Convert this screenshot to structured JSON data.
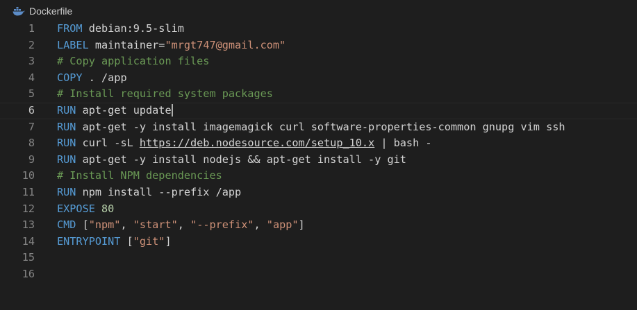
{
  "file": {
    "name": "Dockerfile",
    "icon": "docker-whale-icon"
  },
  "editor": {
    "current_line": 6,
    "lines": [
      {
        "number": "1",
        "tokens": [
          {
            "t": "FROM",
            "c": "kw"
          },
          {
            "t": " debian:9.5-slim",
            "c": ""
          }
        ]
      },
      {
        "number": "2",
        "tokens": [
          {
            "t": "LABEL",
            "c": "kw"
          },
          {
            "t": " maintainer=",
            "c": ""
          },
          {
            "t": "\"mrgt747@gmail.com\"",
            "c": "str"
          }
        ]
      },
      {
        "number": "3",
        "tokens": [
          {
            "t": "# Copy application files",
            "c": "cm"
          }
        ]
      },
      {
        "number": "4",
        "tokens": [
          {
            "t": "COPY",
            "c": "kw"
          },
          {
            "t": " . /app",
            "c": ""
          }
        ]
      },
      {
        "number": "5",
        "tokens": [
          {
            "t": "# Install required system packages",
            "c": "cm"
          }
        ]
      },
      {
        "number": "6",
        "tokens": [
          {
            "t": "RUN",
            "c": "kw"
          },
          {
            "t": " apt-get update",
            "c": ""
          }
        ]
      },
      {
        "number": "7",
        "tokens": [
          {
            "t": "RUN",
            "c": "kw"
          },
          {
            "t": " apt-get -y install imagemagick curl software-properties-common gnupg vim ssh",
            "c": ""
          }
        ]
      },
      {
        "number": "8",
        "tokens": [
          {
            "t": "RUN",
            "c": "kw"
          },
          {
            "t": " curl -sL ",
            "c": ""
          },
          {
            "t": "https://deb.nodesource.com/setup_10.x",
            "c": "url"
          },
          {
            "t": " | bash -",
            "c": ""
          }
        ]
      },
      {
        "number": "9",
        "tokens": [
          {
            "t": "RUN",
            "c": "kw"
          },
          {
            "t": " apt-get -y install nodejs && apt-get install -y git",
            "c": ""
          }
        ]
      },
      {
        "number": "10",
        "tokens": [
          {
            "t": "# Install NPM dependencies",
            "c": "cm"
          }
        ]
      },
      {
        "number": "11",
        "tokens": [
          {
            "t": "RUN",
            "c": "kw"
          },
          {
            "t": " npm install --prefix /app",
            "c": ""
          }
        ]
      },
      {
        "number": "12",
        "tokens": [
          {
            "t": "EXPOSE",
            "c": "kw"
          },
          {
            "t": " ",
            "c": ""
          },
          {
            "t": "80",
            "c": "num"
          }
        ]
      },
      {
        "number": "13",
        "tokens": [
          {
            "t": "CMD",
            "c": "kw"
          },
          {
            "t": " [",
            "c": ""
          },
          {
            "t": "\"npm\"",
            "c": "str"
          },
          {
            "t": ", ",
            "c": ""
          },
          {
            "t": "\"start\"",
            "c": "str"
          },
          {
            "t": ", ",
            "c": ""
          },
          {
            "t": "\"--prefix\"",
            "c": "str"
          },
          {
            "t": ", ",
            "c": ""
          },
          {
            "t": "\"app\"",
            "c": "str"
          },
          {
            "t": "]",
            "c": ""
          }
        ]
      },
      {
        "number": "14",
        "tokens": [
          {
            "t": "ENTRYPOINT",
            "c": "kw"
          },
          {
            "t": " [",
            "c": ""
          },
          {
            "t": "\"git\"",
            "c": "str"
          },
          {
            "t": "]",
            "c": ""
          }
        ]
      },
      {
        "number": "15",
        "tokens": []
      },
      {
        "number": "16",
        "tokens": []
      }
    ]
  },
  "colors": {
    "background": "#1e1e1e",
    "keyword": "#569cd6",
    "comment": "#6a9955",
    "string": "#ce9178",
    "number": "#b5cea8",
    "line_number": "#858585",
    "text": "#d4d4d4"
  }
}
